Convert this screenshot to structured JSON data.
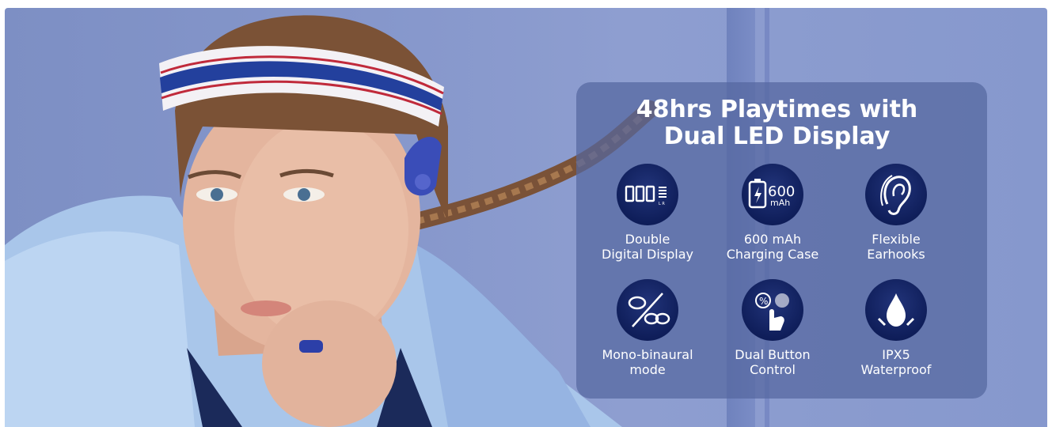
{
  "headline": {
    "line1": "48hrs Playtimes with",
    "line2": "Dual LED Display"
  },
  "features": [
    {
      "icon": "led-display-icon",
      "line1": "Double",
      "line2": "Digital Display"
    },
    {
      "icon": "battery-case-icon",
      "line1": "600 mAh",
      "line2": "Charging Case",
      "icon_text": "600",
      "icon_subtext": "mAh"
    },
    {
      "icon": "earhook-icon",
      "line1": "Flexible",
      "line2": "Earhooks"
    },
    {
      "icon": "mono-binaural-icon",
      "line1": "Mono-binaural",
      "line2": "mode"
    },
    {
      "icon": "touch-button-icon",
      "line1": "Dual Button",
      "line2": "Control"
    },
    {
      "icon": "waterdrop-icon",
      "line1": "IPX5",
      "line2": "Waterproof"
    }
  ],
  "colors": {
    "background": "#8798cc",
    "panel": "#5466a0",
    "icon_circle": "#0f1e5a",
    "text": "#ffffff"
  }
}
